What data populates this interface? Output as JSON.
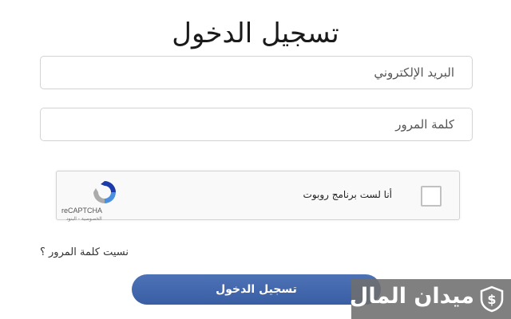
{
  "login": {
    "title": "تسجيل الدخول",
    "email_placeholder": "البريد الإلكتروني",
    "password_placeholder": "كلمة المرور",
    "forgot_password": "نسيت كلمة المرور ؟",
    "submit_label": "تسجيل الدخول"
  },
  "captcha": {
    "label": "أنا لست برنامج روبوت",
    "brand": "reCAPTCHA",
    "terms": "الخصوصية - البنود"
  },
  "watermark": {
    "text": "ميدان المال",
    "icon": "dollar-shield-icon"
  },
  "colors": {
    "button": "#3f63a8",
    "watermark_bg": "#6e6e6e",
    "field_border": "#d3d3d3"
  }
}
